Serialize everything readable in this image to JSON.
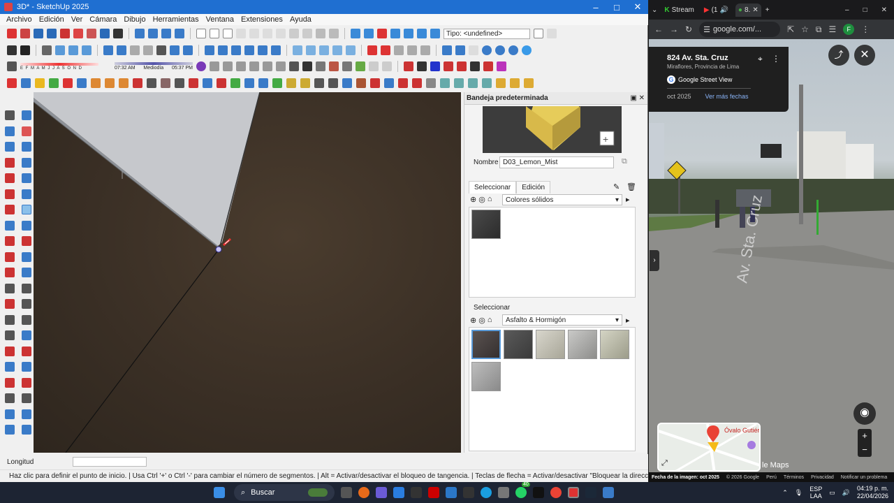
{
  "sketchup": {
    "window_title": "3D* - SketchUp 2025",
    "menu": [
      "Archivo",
      "Edición",
      "Ver",
      "Cámara",
      "Dibujo",
      "Herramientas",
      "Ventana",
      "Extensiones",
      "Ayuda"
    ],
    "type_box": "Tipo: <undefined>",
    "shadow_months": "E F M A M J J A S O N D",
    "time_start": "07:32 AM",
    "time_mid": "Mediodía",
    "time_end": "05:37 PM",
    "tray_title": "Bandeja predeterminada",
    "name_label": "Nombre",
    "material_name": "D03_Lemon_Mist",
    "tab_select": "Seleccionar",
    "tab_edit": "Edición",
    "library1": "Colores sólidos",
    "select_label2": "Seleccionar",
    "library2": "Asfalto & Hormigón",
    "status_label": "Longitud",
    "hint": "Haz clic para definir el punto de inicio. | Usa Ctrl '+' o Ctrl '-' para cambiar el número de segmentos. | Alt = Activar/desactivar el bloqueo de tangencia. | Teclas de flecha = Activar/desactivar \"Bloquear la dirección de la infer..."
  },
  "chrome": {
    "tabs": [
      {
        "label": "Stream"
      },
      {
        "label": "(1"
      },
      {
        "label": "8."
      }
    ],
    "url": "google.com/...",
    "place": "824 Av. Sta. Cruz",
    "place_sub": "Miraflores, Provincia de Lima",
    "service": "Google Street View",
    "date": "oct 2025",
    "more_dates": "Ver más fechas",
    "street_label": "Av. Sta. Cruz",
    "minimap_label": "Óvalo Gutiérre",
    "maps_label": "le Maps",
    "footer": [
      "Fecha de la imagen: oct 2025",
      "© 2026 Google",
      "Perú",
      "Términos",
      "Privacidad",
      "Notificar un problema"
    ]
  },
  "taskbar": {
    "search": "Buscar",
    "lang": "ESP",
    "lang2": "LAA",
    "time": "04:19 p. m.",
    "date": "22/04/2026",
    "badge": "40"
  }
}
